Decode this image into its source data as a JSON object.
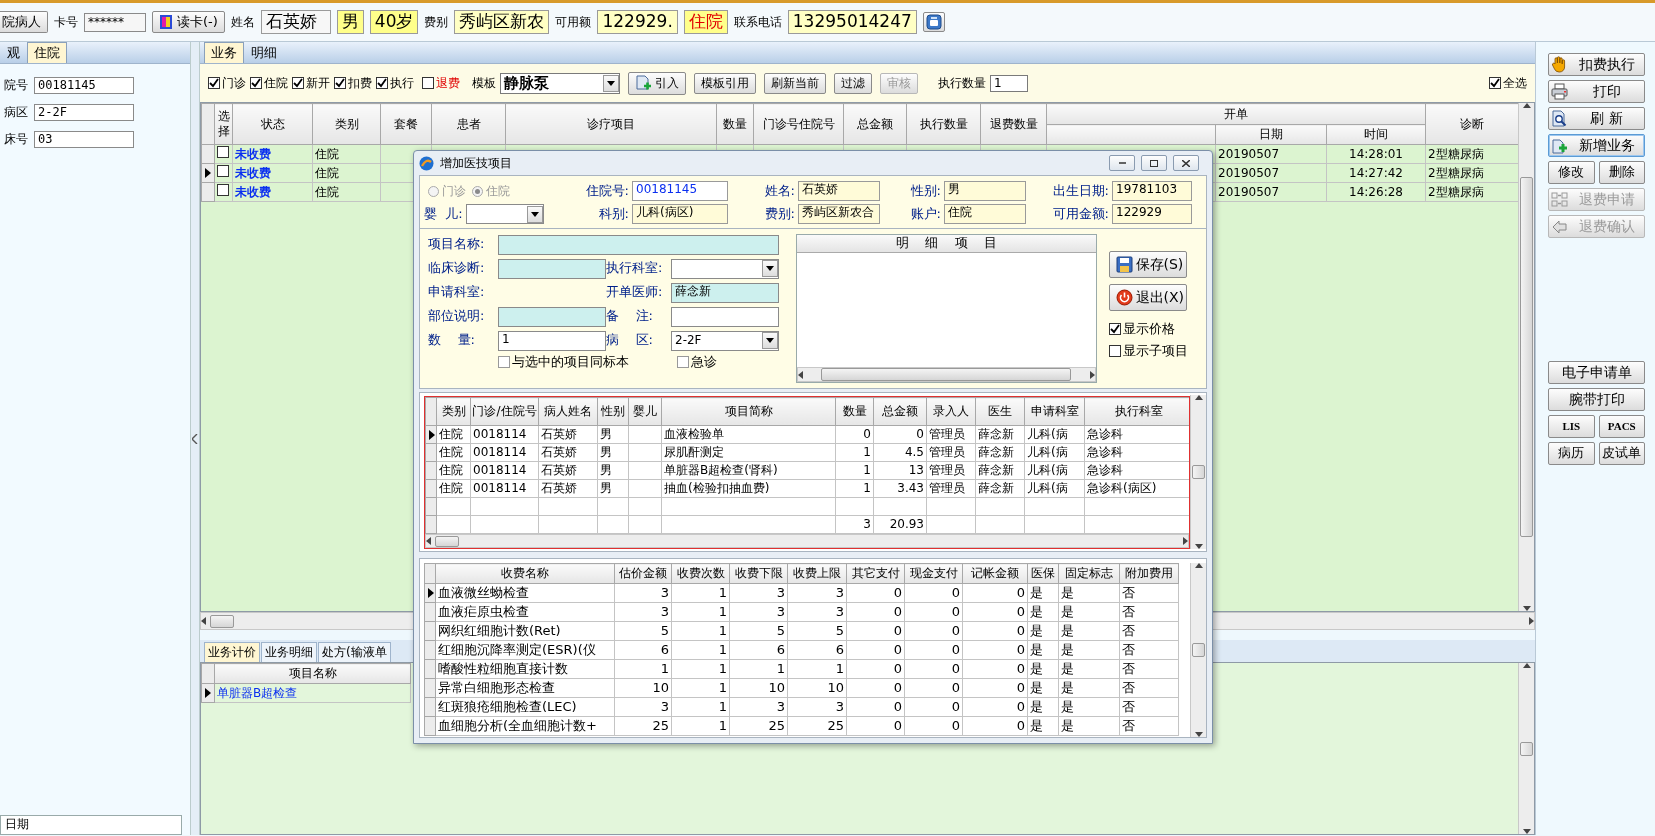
{
  "top_bar": {
    "items": [
      {
        "kind": "button",
        "text": "院病人"
      },
      {
        "kind": "label",
        "text": "卡号"
      },
      {
        "kind": "masked",
        "text": "******"
      },
      {
        "kind": "card-button",
        "text": "读卡(-)"
      },
      {
        "kind": "label",
        "text": "姓名"
      },
      {
        "kind": "name",
        "text": "石英娇"
      },
      {
        "kind": "badge",
        "text": "男"
      },
      {
        "kind": "badge",
        "text": "40岁"
      },
      {
        "kind": "label",
        "text": "费别"
      },
      {
        "kind": "value",
        "text": "秀屿区新农"
      },
      {
        "kind": "label",
        "text": "可用额"
      },
      {
        "kind": "value",
        "text": "122929."
      },
      {
        "kind": "alert",
        "text": "住院"
      },
      {
        "kind": "label",
        "text": "联系电话"
      },
      {
        "kind": "value",
        "text": "13295014247"
      },
      {
        "kind": "icon-button"
      }
    ]
  },
  "left_panel": {
    "tabs": [
      {
        "label": "观",
        "selected": false
      },
      {
        "label": "住院",
        "selected": true
      }
    ],
    "fields": [
      {
        "label": "院号",
        "value": "00181145"
      },
      {
        "label": "病区",
        "value": "2-2F"
      },
      {
        "label": "床号",
        "value": "03"
      }
    ],
    "footer": "日期"
  },
  "main": {
    "tabs": [
      {
        "label": "业务",
        "selected": true
      },
      {
        "label": "明细",
        "selected": false
      }
    ],
    "filters": [
      {
        "label": "门诊",
        "checked": true,
        "kind": "normal"
      },
      {
        "label": "住院",
        "checked": true,
        "kind": "normal"
      },
      {
        "label": "新开",
        "checked": true,
        "kind": "normal"
      },
      {
        "label": "扣费",
        "checked": true,
        "kind": "normal"
      },
      {
        "label": "执行",
        "checked": true,
        "kind": "normal"
      },
      {
        "label": "退费",
        "checked": false,
        "kind": "alert"
      }
    ],
    "template_label": "模板",
    "template": "静脉泵",
    "buttons": [
      {
        "label": "引入",
        "kind": "import",
        "disabled": false
      },
      {
        "label": "模板引用",
        "kind": "plain",
        "disabled": false
      },
      {
        "label": "刷新当前",
        "kind": "plain",
        "disabled": false
      },
      {
        "label": "过滤",
        "kind": "plain",
        "disabled": false
      },
      {
        "label": "审核",
        "kind": "plain",
        "disabled": true
      }
    ],
    "exec_label": "执行数量",
    "exec_value": "1",
    "select_all": {
      "label": "全选",
      "checked": true
    },
    "table": {
      "columns": [
        {
          "label": "选择"
        },
        {
          "label": "状态"
        },
        {
          "label": "类别"
        },
        {
          "label": "套餐"
        },
        {
          "label": "患者"
        },
        {
          "label": "诊疗项目"
        },
        {
          "label": "数量"
        },
        {
          "label": "门诊号住院号"
        },
        {
          "label": "总金额"
        },
        {
          "label": "执行数量"
        },
        {
          "label": "退费数量"
        },
        {
          "label": "开单",
          "children": [
            {
              "label": "日期"
            },
            {
              "label": "时间"
            }
          ]
        },
        {
          "label": "诊断"
        }
      ],
      "rows": [
        {
          "checked": false,
          "current": false,
          "status": "未收费",
          "category": "住院",
          "date": "20190507",
          "time": "14:28:01",
          "diagnosis": "2型糖尿病"
        },
        {
          "checked": false,
          "current": true,
          "status": "未收费",
          "category": "住院",
          "date": "20190507",
          "time": "14:27:42",
          "diagnosis": "2型糖尿病"
        },
        {
          "checked": false,
          "current": false,
          "status": "未收费",
          "category": "住院",
          "date": "20190507",
          "time": "14:26:28",
          "diagnosis": "2型糖尿病"
        }
      ]
    }
  },
  "bottom": {
    "tabs": [
      {
        "label": "业务计价",
        "selected": true
      },
      {
        "label": "业务明细",
        "selected": false
      },
      {
        "label": "处方(输液单",
        "selected": false
      }
    ],
    "columns": [
      "项目名称"
    ],
    "rows": [
      {
        "current": true,
        "name": "单脏器B超检查"
      }
    ]
  },
  "right_panel": {
    "groups": [
      [
        [
          {
            "label": "扣费执行",
            "kind": "hand",
            "disabled": false,
            "focused": false
          }
        ],
        [
          {
            "label": "打印",
            "kind": "printer",
            "disabled": false,
            "focused": false
          }
        ],
        [
          {
            "label": "刷 新",
            "kind": "search",
            "disabled": false,
            "focused": false
          }
        ],
        [
          {
            "label": "新增业务",
            "kind": "add",
            "disabled": false,
            "focused": true
          }
        ],
        [
          {
            "label": "修改",
            "kind": "plain",
            "disabled": false,
            "focused": false
          },
          {
            "label": "删除",
            "kind": "plain",
            "disabled": false,
            "focused": false
          }
        ],
        [
          {
            "label": "退费申请",
            "kind": "transfer",
            "disabled": true,
            "focused": false
          }
        ],
        [
          {
            "label": "退费确认",
            "kind": "back",
            "disabled": true,
            "focused": false
          }
        ]
      ],
      [
        [
          {
            "label": "电子申请单",
            "kind": "plain",
            "disabled": false,
            "focused": false
          }
        ],
        [
          {
            "label": "腕带打印",
            "kind": "plain",
            "disabled": false,
            "focused": false
          }
        ],
        [
          {
            "label": "LIS",
            "kind": "code",
            "disabled": false,
            "focused": false
          },
          {
            "label": "PACS",
            "kind": "code",
            "disabled": false,
            "focused": false
          }
        ],
        [
          {
            "label": "病历",
            "kind": "plain",
            "disabled": false,
            "focused": false
          },
          {
            "label": "皮试单",
            "kind": "plain",
            "disabled": false,
            "focused": false
          }
        ]
      ]
    ]
  },
  "dialog": {
    "title": "增加医技项目",
    "visit_types": [
      {
        "label": "门诊",
        "selected": false,
        "disabled": true
      },
      {
        "label": "住院",
        "selected": true,
        "disabled": true
      }
    ],
    "baby_label": "婴  儿:",
    "patient_rows": [
      [
        {
          "label": "住院号:",
          "value": "00181145",
          "kind": "input"
        },
        {
          "label": "姓名:",
          "value": "石英娇",
          "kind": "readonly"
        },
        {
          "label": "性别:",
          "value": "男",
          "kind": "readonly"
        },
        {
          "label": "出生日期:",
          "value": "19781103",
          "kind": "readonly"
        }
      ],
      [
        {
          "label": "科别:",
          "value": "儿科(病区)",
          "kind": "readonly"
        },
        {
          "label": "费别:",
          "value": "秀屿区新农合",
          "kind": "readonly"
        },
        {
          "label": "账户:",
          "value": "住院",
          "kind": "readonly"
        },
        {
          "label": "可用金额:",
          "value": "122929",
          "kind": "readonly"
        }
      ]
    ],
    "form_rows": [
      [
        {
          "label": "项目名称:",
          "kind": "highlight"
        }
      ],
      [
        {
          "label": "临床诊断:",
          "kind": "highlight"
        },
        {
          "label": "执行科室:",
          "kind": "select"
        }
      ],
      [
        {
          "label": "申请科室:",
          "kind": "none"
        },
        {
          "label": "开单医师:",
          "kind": "highlight",
          "value": "薛念新"
        }
      ],
      [
        {
          "label": "部位说明:",
          "kind": "highlight"
        },
        {
          "label": "备    注:",
          "kind": "input"
        }
      ],
      [
        {
          "label": "数    量:",
          "kind": "input",
          "value": "1"
        },
        {
          "label": "病    区:",
          "kind": "select",
          "value": "2-2F"
        }
      ]
    ],
    "options": [
      {
        "label": "与选中的项目同标本",
        "checked": false
      },
      {
        "label": "急诊",
        "checked": false
      }
    ],
    "detail_title": "明    细    项    目",
    "buttons": [
      {
        "label": "保存(S)",
        "kind": "save"
      },
      {
        "label": "退出(X)",
        "kind": "exit"
      }
    ],
    "toggles": [
      {
        "label": "显示价格",
        "checked": true
      },
      {
        "label": "显示子项目",
        "checked": false
      }
    ],
    "items": {
      "columns": [
        "类别",
        "门诊/住院号",
        "病人姓名",
        "性别",
        "婴儿",
        "项目简称",
        "数量",
        "总金额",
        "录入人",
        "医生",
        "申请科室",
        "执行科室"
      ],
      "rows": [
        {
          "current": true,
          "category": "住院",
          "visit_no": "0018114",
          "patient": "石英娇",
          "sex": "男",
          "item": "血液检验单",
          "qty": "0",
          "amount": "0",
          "entered_by": "管理员",
          "doctor": "薛念新",
          "dept": "儿科(病",
          "exec_dept": "急诊科"
        },
        {
          "current": false,
          "category": "住院",
          "visit_no": "0018114",
          "patient": "石英娇",
          "sex": "男",
          "item": "尿肌酐测定",
          "qty": "1",
          "amount": "4.5",
          "entered_by": "管理员",
          "doctor": "薛念新",
          "dept": "儿科(病",
          "exec_dept": "急诊科"
        },
        {
          "current": false,
          "category": "住院",
          "visit_no": "0018114",
          "patient": "石英娇",
          "sex": "男",
          "item": "单脏器B超检查(肾科)",
          "qty": "1",
          "amount": "13",
          "entered_by": "管理员",
          "doctor": "薛念新",
          "dept": "儿科(病",
          "exec_dept": "急诊科"
        },
        {
          "current": false,
          "category": "住院",
          "visit_no": "0018114",
          "patient": "石英娇",
          "sex": "男",
          "item": "抽血(检验扣抽血费)",
          "qty": "1",
          "amount": "3.43",
          "entered_by": "管理员",
          "doctor": "薛念新",
          "dept": "儿科(病",
          "exec_dept": "急诊科(病区)"
        }
      ],
      "total": {
        "qty": "3",
        "amount": "20.93"
      }
    },
    "fees": {
      "columns": [
        "收费名称",
        "估价金额",
        "收费次数",
        "收费下限",
        "收费上限",
        "其它支付",
        "现金支付",
        "记帐金额",
        "医保",
        "固定标志",
        "附加费用"
      ],
      "rows": [
        {
          "current": true,
          "cells": [
            "血液微丝蚴检查",
            "3",
            "1",
            "3",
            "3",
            "0",
            "0",
            "0",
            "是",
            "是",
            "否"
          ]
        },
        {
          "current": false,
          "cells": [
            "血液疟原虫检查",
            "3",
            "1",
            "3",
            "3",
            "0",
            "0",
            "0",
            "是",
            "是",
            "否"
          ]
        },
        {
          "current": false,
          "cells": [
            "网织红细胞计数(Ret)",
            "5",
            "1",
            "5",
            "5",
            "0",
            "0",
            "0",
            "是",
            "是",
            "否"
          ]
        },
        {
          "current": false,
          "cells": [
            "红细胞沉降率测定(ESR)(仪",
            "6",
            "1",
            "6",
            "6",
            "0",
            "0",
            "0",
            "是",
            "是",
            "否"
          ]
        },
        {
          "current": false,
          "cells": [
            "嗜酸性粒细胞直接计数",
            "1",
            "1",
            "1",
            "1",
            "0",
            "0",
            "0",
            "是",
            "是",
            "否"
          ]
        },
        {
          "current": false,
          "cells": [
            "异常白细胞形态检查",
            "10",
            "1",
            "10",
            "10",
            "0",
            "0",
            "0",
            "是",
            "是",
            "否"
          ]
        },
        {
          "current": false,
          "cells": [
            "红斑狼疮细胞检查(LEC)",
            "3",
            "1",
            "3",
            "3",
            "0",
            "0",
            "0",
            "是",
            "是",
            "否"
          ]
        },
        {
          "current": false,
          "cells": [
            "血细胞分析(全血细胞计数+",
            "25",
            "1",
            "25",
            "25",
            "0",
            "0",
            "0",
            "是",
            "是",
            "否"
          ]
        }
      ]
    }
  }
}
